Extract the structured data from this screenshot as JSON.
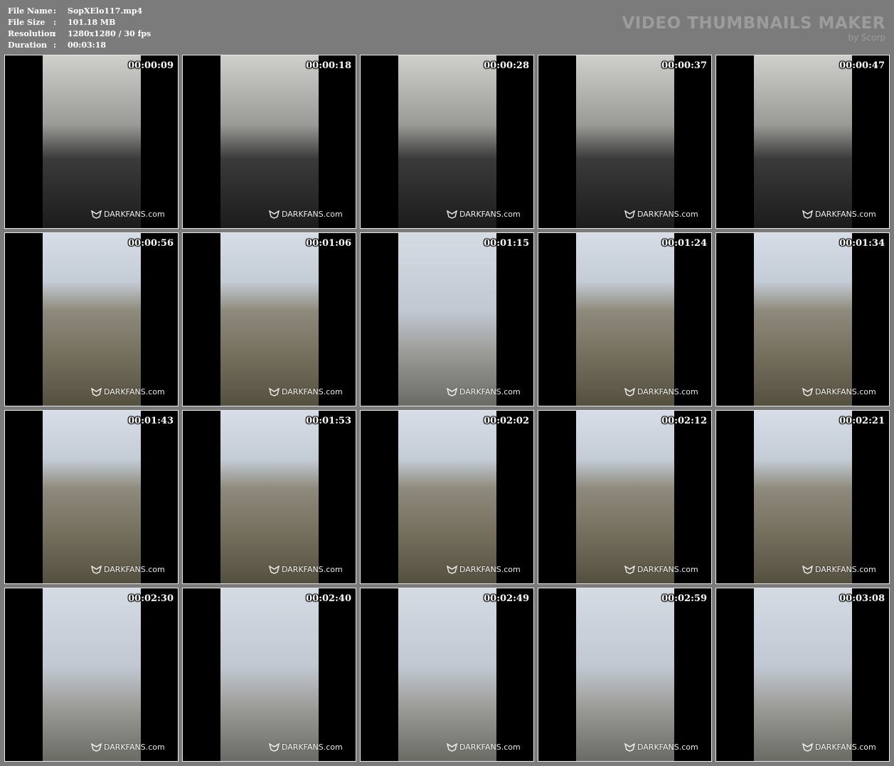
{
  "info": [
    {
      "key": "File Name",
      "value": "SopXElo117.mp4"
    },
    {
      "key": "File Size",
      "value": "101.18 MB"
    },
    {
      "key": "Resolution",
      "value": "1280x1280 / 30 fps"
    },
    {
      "key": "Duration",
      "value": "00:03:18"
    }
  ],
  "separator": ":",
  "brand": {
    "title": "VIDEO THUMBNAILS MAKER",
    "subtitle": "by Scorp"
  },
  "watermark": "DARKFANS.com",
  "thumbnails": [
    {
      "time": "00:00:09",
      "scene": "close"
    },
    {
      "time": "00:00:18",
      "scene": "close"
    },
    {
      "time": "00:00:28",
      "scene": "close"
    },
    {
      "time": "00:00:37",
      "scene": "close"
    },
    {
      "time": "00:00:47",
      "scene": "close"
    },
    {
      "time": "00:00:56",
      "scene": "rail"
    },
    {
      "time": "00:01:06",
      "scene": "rail"
    },
    {
      "time": "00:01:15",
      "scene": "sky"
    },
    {
      "time": "00:01:24",
      "scene": "rail"
    },
    {
      "time": "00:01:34",
      "scene": "rail"
    },
    {
      "time": "00:01:43",
      "scene": "rail"
    },
    {
      "time": "00:01:53",
      "scene": "rail"
    },
    {
      "time": "00:02:02",
      "scene": "rail"
    },
    {
      "time": "00:02:12",
      "scene": "rail"
    },
    {
      "time": "00:02:21",
      "scene": "rail"
    },
    {
      "time": "00:02:30",
      "scene": "sky"
    },
    {
      "time": "00:02:40",
      "scene": "sky"
    },
    {
      "time": "00:02:49",
      "scene": "sky"
    },
    {
      "time": "00:02:59",
      "scene": "sky"
    },
    {
      "time": "00:03:08",
      "scene": "sky"
    }
  ]
}
